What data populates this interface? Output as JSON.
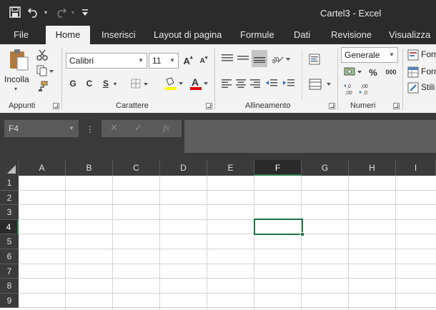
{
  "window": {
    "title": "Cartel3 - Excel"
  },
  "quick_access": {
    "save_icon": "save-icon",
    "undo_icon": "undo-icon",
    "redo_icon": "redo-icon",
    "customize_icon": "customize-qat-icon"
  },
  "tabs": [
    {
      "label": "File"
    },
    {
      "label": "Home"
    },
    {
      "label": "Inserisci"
    },
    {
      "label": "Layout di pagina"
    },
    {
      "label": "Formule"
    },
    {
      "label": "Dati"
    },
    {
      "label": "Revisione"
    },
    {
      "label": "Visualizza"
    }
  ],
  "ribbon": {
    "clipboard": {
      "paste_label": "Incolla",
      "group_label": "Appunti"
    },
    "font": {
      "font_name": "Calibri",
      "font_size": "11",
      "bold": "G",
      "italic": "C",
      "underline": "S",
      "group_label": "Carattere"
    },
    "alignment": {
      "group_label": "Allineamento"
    },
    "number": {
      "format": "Generale",
      "percent": "%",
      "thousands": "000",
      "inc_decimals": "←,0\n,00",
      "dec_decimals": ",00\n→,0",
      "group_label": "Numeri"
    },
    "styles": {
      "item1": "Form",
      "item2": "Form",
      "item3": "Stili"
    }
  },
  "formula_bar": {
    "name_box": "F4",
    "cancel": "✕",
    "enter": "✓",
    "fx": "fx",
    "value": ""
  },
  "sheet": {
    "columns": [
      "A",
      "B",
      "C",
      "D",
      "E",
      "F",
      "G",
      "H",
      "I"
    ],
    "rows": [
      "1",
      "2",
      "3",
      "4",
      "5",
      "6",
      "7",
      "8",
      "9"
    ],
    "selected_column": "F",
    "selected_row": "4"
  },
  "colors": {
    "accent": "#217346",
    "titlebar": "#2b2b2b",
    "ribbon": "#f3f3f3"
  }
}
